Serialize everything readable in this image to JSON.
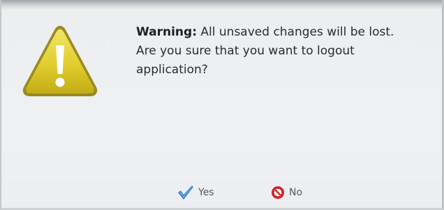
{
  "dialog": {
    "icon": "warning-triangle-icon",
    "message": {
      "strong": "Warning:",
      "line1": "All unsaved changes will be lost.",
      "line2": "Are you sure that you want to logout",
      "line3": "application?"
    },
    "buttons": {
      "yes": {
        "label": "Yes",
        "icon": "checkmark-icon"
      },
      "no": {
        "label": "No",
        "icon": "no-entry-icon"
      }
    },
    "colors": {
      "warning_fill": "#e3cf2e",
      "warning_border": "#8f7e1c",
      "yes_check": "#3c7fc4",
      "no_icon": "#d2242a"
    }
  }
}
